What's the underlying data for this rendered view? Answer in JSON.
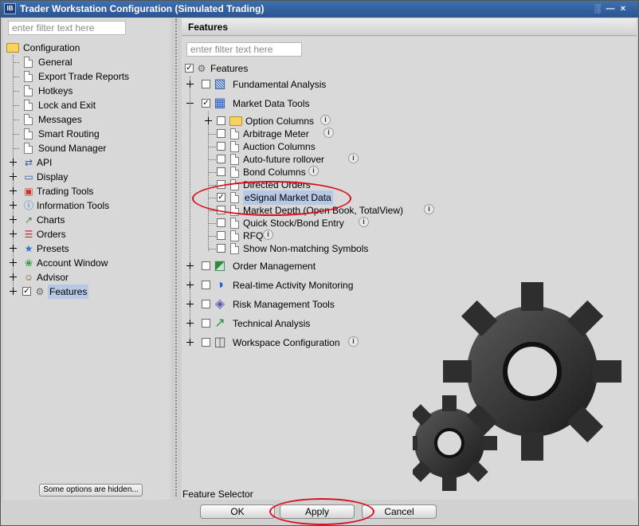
{
  "window": {
    "title": "Trader Workstation Configuration (Simulated Trading)",
    "app_icon": "IB",
    "controls": [
      "░",
      "—",
      "×"
    ]
  },
  "left_panel": {
    "filter_placeholder": "enter filter text here",
    "root": "Configuration",
    "general_items": [
      "General",
      "Export Trade Reports",
      "Hotkeys",
      "Lock and Exit",
      "Messages",
      "Smart Routing",
      "Sound Manager"
    ],
    "groups": [
      {
        "label": "API",
        "icon": "api-icon"
      },
      {
        "label": "Display",
        "icon": "display-icon"
      },
      {
        "label": "Trading Tools",
        "icon": "trading-tools-icon"
      },
      {
        "label": "Information Tools",
        "icon": "info-icon"
      },
      {
        "label": "Charts",
        "icon": "chart-icon"
      },
      {
        "label": "Orders",
        "icon": "orders-icon"
      },
      {
        "label": "Presets",
        "icon": "presets-icon"
      },
      {
        "label": "Account Window",
        "icon": "account-window-icon"
      },
      {
        "label": "Advisor",
        "icon": "advisor-icon"
      },
      {
        "label": "Features",
        "icon": "features-gear-icon"
      }
    ],
    "hidden_button": "Some options are hidden..."
  },
  "right_panel": {
    "header": "Features",
    "filter_placeholder": "enter filter text here",
    "root_label": "Features",
    "fundamental": "Fundamental Analysis",
    "market_data_tools": "Market Data Tools",
    "mdt_children": [
      {
        "label": "Option Columns",
        "checked": false,
        "info": true,
        "folder": true
      },
      {
        "label": "Arbitrage Meter",
        "checked": false,
        "info": true
      },
      {
        "label": "Auction Columns",
        "checked": false,
        "info": false
      },
      {
        "label": "Auto-future rollover",
        "checked": false,
        "info": true
      },
      {
        "label": "Bond Columns",
        "checked": false,
        "info": true
      },
      {
        "label": "Directed Orders",
        "checked": false,
        "info": false
      },
      {
        "label": "eSignal Market Data",
        "checked": true,
        "info": false
      },
      {
        "label": "Market Depth (Open Book, TotalView)",
        "checked": false,
        "info": true
      },
      {
        "label": "Quick Stock/Bond Entry",
        "checked": false,
        "info": true
      },
      {
        "label": "RFQ",
        "checked": false,
        "info": true
      },
      {
        "label": "Show Non-matching Symbols",
        "checked": false,
        "info": false
      }
    ],
    "other_groups": [
      "Order Management",
      "Real-time Activity Monitoring",
      "Risk Management Tools",
      "Technical Analysis",
      "Workspace Configuration"
    ],
    "info_glyph": "i",
    "feature_selector": "Feature Selector"
  },
  "buttons": {
    "ok": "OK",
    "apply": "Apply",
    "cancel": "Cancel"
  },
  "colors": {
    "title_bar": "#2f5f9f",
    "selection": "#b6c8e6",
    "annotation": "#d8101e"
  }
}
